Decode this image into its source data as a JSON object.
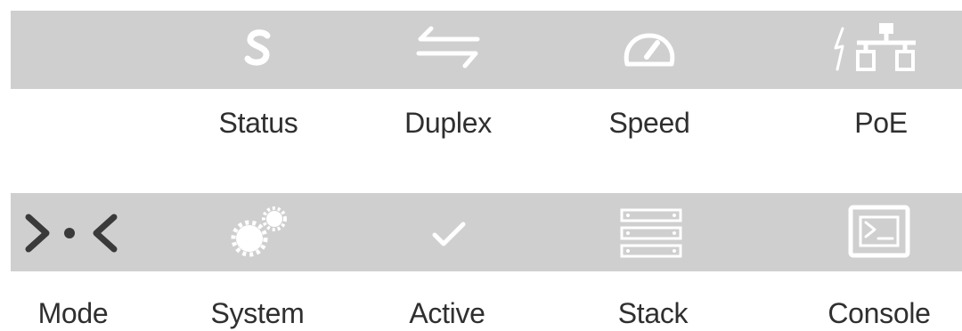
{
  "colors": {
    "bar_background": "#cfcfcf",
    "icon_light": "#ffffff",
    "icon_dark": "#3a3a3a",
    "label_text": "#2f2f2f"
  },
  "top_row": {
    "icons": [
      "status-s-icon",
      "duplex-arrows-icon",
      "speed-gauge-icon",
      "poe-network-icon"
    ],
    "labels": {
      "status": "Status",
      "duplex": "Duplex",
      "speed": "Speed",
      "poe": "PoE"
    }
  },
  "bottom_row": {
    "icons": [
      "mode-icon",
      "system-gears-icon",
      "active-check-icon",
      "stack-icon",
      "console-icon"
    ],
    "labels": {
      "mode": "Mode",
      "system": "System",
      "active": "Active",
      "stack": "Stack",
      "console": "Console"
    }
  }
}
